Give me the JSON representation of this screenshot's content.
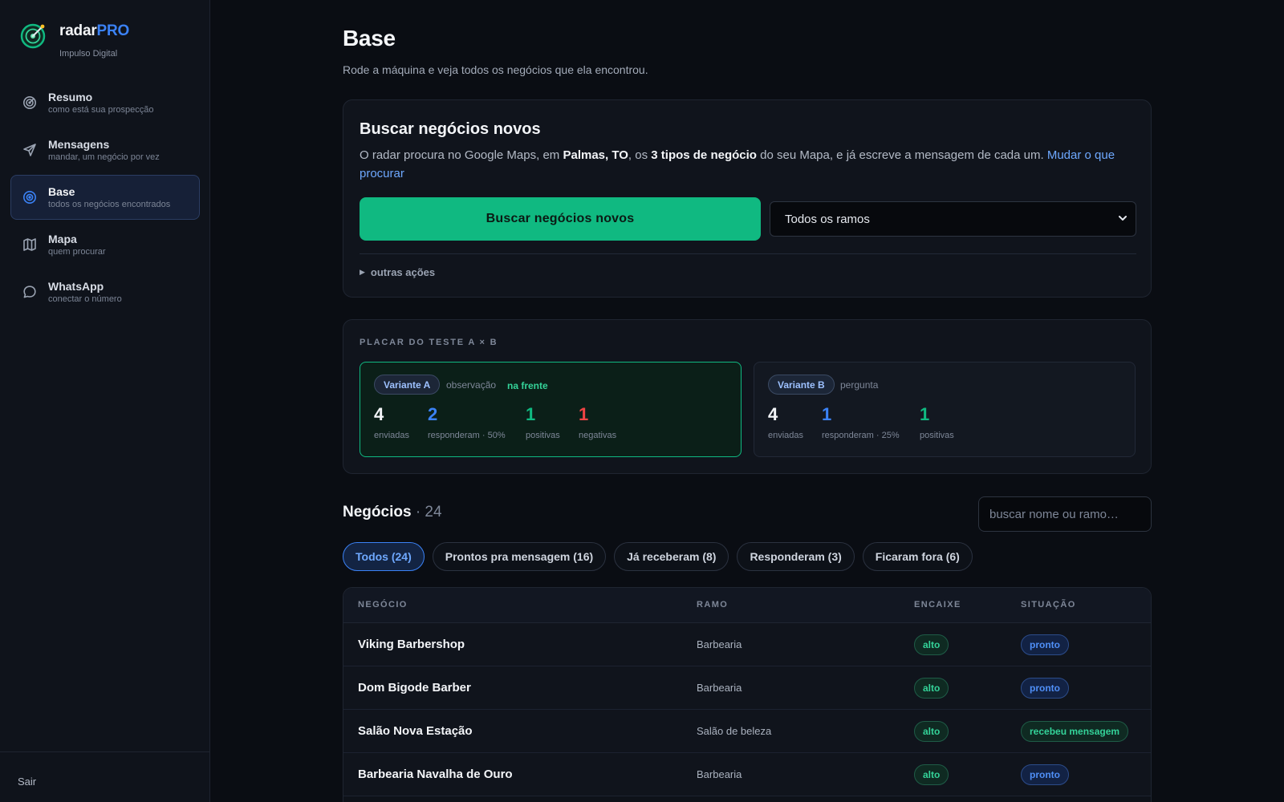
{
  "brand": {
    "name_main": "radar",
    "name_accent": "PRO",
    "subtitle": "Impulso Digital"
  },
  "nav": [
    {
      "label": "Resumo",
      "sub": "como está sua prospecção",
      "icon": "target-icon",
      "active": false
    },
    {
      "label": "Mensagens",
      "sub": "mandar, um negócio por vez",
      "icon": "send-icon",
      "active": false
    },
    {
      "label": "Base",
      "sub": "todos os negócios encontrados",
      "icon": "radar-icon",
      "active": true
    },
    {
      "label": "Mapa",
      "sub": "quem procurar",
      "icon": "map-icon",
      "active": false
    },
    {
      "label": "WhatsApp",
      "sub": "conectar o número",
      "icon": "chat-icon",
      "active": false
    }
  ],
  "logout": "Sair",
  "page": {
    "title": "Base",
    "subtitle": "Rode a máquina e veja todos os negócios que ela encontrou."
  },
  "search": {
    "title": "Buscar negócios novos",
    "desc_1": "O radar procura no Google Maps, em ",
    "location": "Palmas, TO",
    "desc_2": ", os ",
    "types": "3 tipos de negócio",
    "desc_3": " do seu Mapa, e já escreve a mensagem de cada um. ",
    "change_link": "Mudar o que procurar",
    "button": "Buscar negócios novos",
    "select_value": "Todos os ramos",
    "more_actions": "outras ações"
  },
  "ab_test": {
    "title": "PLACAR DO TESTE A × B",
    "variant_a": {
      "badge": "Variante A",
      "type": "observação",
      "ahead": "na frente",
      "sent": "4",
      "sent_label": "enviadas",
      "replied": "2",
      "replied_label": "responderam · 50%",
      "positive": "1",
      "positive_label": "positivas",
      "negative": "1",
      "negative_label": "negativas"
    },
    "variant_b": {
      "badge": "Variante B",
      "type": "pergunta",
      "sent": "4",
      "sent_label": "enviadas",
      "replied": "1",
      "replied_label": "responderam · 25%",
      "positive": "1",
      "positive_label": "positivas"
    }
  },
  "list": {
    "title": "Negócios",
    "count": "· 24",
    "search_placeholder": "buscar nome ou ramo…",
    "filters": [
      {
        "label": "Todos (24)",
        "active": true
      },
      {
        "label": "Prontos pra mensagem (16)",
        "active": false
      },
      {
        "label": "Já receberam (8)",
        "active": false
      },
      {
        "label": "Responderam (3)",
        "active": false
      },
      {
        "label": "Ficaram fora (6)",
        "active": false
      }
    ],
    "columns": [
      "NEGÓCIO",
      "RAMO",
      "ENCAIXE",
      "SITUAÇÃO"
    ],
    "rows": [
      {
        "name": "Viking Barbershop",
        "ramo": "Barbearia",
        "fit": "alto",
        "status": "pronto"
      },
      {
        "name": "Dom Bigode Barber",
        "ramo": "Barbearia",
        "fit": "alto",
        "status": "pronto"
      },
      {
        "name": "Salão Nova Estação",
        "ramo": "Salão de beleza",
        "fit": "alto",
        "status": "recebeu mensagem"
      },
      {
        "name": "Barbearia Navalha de Ouro",
        "ramo": "Barbearia",
        "fit": "alto",
        "status": "pronto"
      }
    ]
  },
  "colors": {
    "accent_blue": "#3b82f6",
    "accent_green": "#10b981",
    "negative_red": "#ef4444",
    "background": "#0a0d13"
  }
}
